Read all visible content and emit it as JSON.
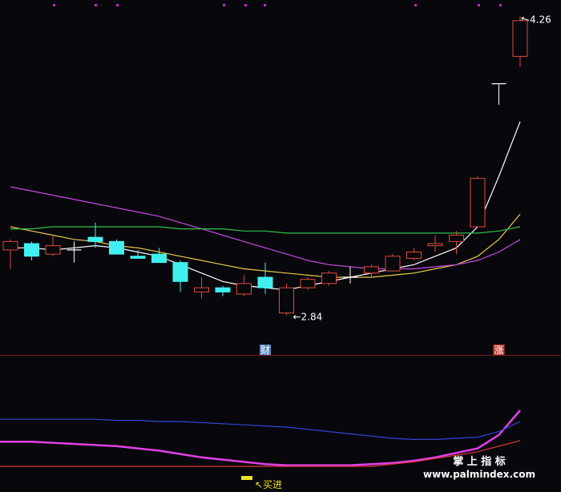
{
  "chart_data": {
    "type": "candlestick",
    "main_panel": {
      "y_range": [
        2.7,
        4.3
      ],
      "candles": [
        {
          "o": 3.15,
          "h": 3.2,
          "l": 3.06,
          "c": 3.19
        },
        {
          "o": 3.18,
          "h": 3.19,
          "l": 3.1,
          "c": 3.12
        },
        {
          "o": 3.13,
          "h": 3.22,
          "l": 3.12,
          "c": 3.17
        },
        {
          "o": 3.15,
          "h": 3.19,
          "l": 3.09,
          "c": 3.15
        },
        {
          "o": 3.21,
          "h": 3.28,
          "l": 3.16,
          "c": 3.19
        },
        {
          "o": 3.19,
          "h": 3.2,
          "l": 3.13,
          "c": 3.13
        },
        {
          "o": 3.12,
          "h": 3.15,
          "l": 3.11,
          "c": 3.11
        },
        {
          "o": 3.13,
          "h": 3.16,
          "l": 3.09,
          "c": 3.09
        },
        {
          "o": 3.09,
          "h": 3.1,
          "l": 2.95,
          "c": 3.0
        },
        {
          "o": 2.95,
          "h": 3.02,
          "l": 2.92,
          "c": 2.97
        },
        {
          "o": 2.97,
          "h": 2.98,
          "l": 2.93,
          "c": 2.95
        },
        {
          "o": 2.94,
          "h": 3.03,
          "l": 2.93,
          "c": 2.99
        },
        {
          "o": 3.02,
          "h": 3.09,
          "l": 2.94,
          "c": 2.97
        },
        {
          "o": 2.85,
          "h": 2.99,
          "l": 2.84,
          "c": 2.97
        },
        {
          "o": 2.97,
          "h": 3.02,
          "l": 2.96,
          "c": 3.01
        },
        {
          "o": 2.99,
          "h": 3.05,
          "l": 2.98,
          "c": 3.04
        },
        {
          "o": 3.02,
          "h": 3.07,
          "l": 2.99,
          "c": 3.02
        },
        {
          "o": 3.04,
          "h": 3.08,
          "l": 3.02,
          "c": 3.07
        },
        {
          "o": 3.05,
          "h": 3.13,
          "l": 3.05,
          "c": 3.12
        },
        {
          "o": 3.11,
          "h": 3.16,
          "l": 3.1,
          "c": 3.14
        },
        {
          "o": 3.17,
          "h": 3.22,
          "l": 3.14,
          "c": 3.18
        },
        {
          "o": 3.19,
          "h": 3.24,
          "l": 3.13,
          "c": 3.22
        },
        {
          "o": 3.26,
          "h": 3.5,
          "l": 3.26,
          "c": 3.49
        },
        {
          "o": 3.94,
          "h": 3.94,
          "l": 3.84,
          "c": 3.94
        },
        {
          "o": 4.07,
          "h": 4.26,
          "l": 4.02,
          "c": 4.24
        }
      ],
      "lines": [
        {
          "color": "#ffffff",
          "values": [
            3.16,
            3.16,
            3.15,
            3.16,
            3.17,
            3.16,
            3.14,
            3.12,
            3.08,
            3.04,
            3.0,
            2.98,
            2.97,
            2.96,
            2.98,
            3.0,
            3.02,
            3.04,
            3.06,
            3.08,
            3.12,
            3.16,
            3.26,
            3.5,
            3.76
          ]
        },
        {
          "color": "#e8c84a",
          "values": [
            3.26,
            3.24,
            3.22,
            3.2,
            3.19,
            3.17,
            3.16,
            3.14,
            3.12,
            3.1,
            3.08,
            3.06,
            3.05,
            3.04,
            3.03,
            3.02,
            3.02,
            3.02,
            3.03,
            3.04,
            3.06,
            3.08,
            3.12,
            3.2,
            3.32
          ]
        },
        {
          "color": "#c548e0",
          "values": [
            3.45,
            3.43,
            3.41,
            3.39,
            3.37,
            3.35,
            3.33,
            3.31,
            3.28,
            3.25,
            3.22,
            3.19,
            3.16,
            3.13,
            3.1,
            3.08,
            3.07,
            3.06,
            3.06,
            3.06,
            3.07,
            3.08,
            3.1,
            3.14,
            3.2
          ]
        },
        {
          "color": "#2fc24a",
          "values": [
            3.25,
            3.25,
            3.26,
            3.26,
            3.26,
            3.26,
            3.26,
            3.26,
            3.25,
            3.25,
            3.25,
            3.24,
            3.24,
            3.23,
            3.23,
            3.23,
            3.23,
            3.23,
            3.23,
            3.23,
            3.23,
            3.23,
            3.23,
            3.24,
            3.26
          ]
        }
      ],
      "annotations": [
        {
          "text": "4.26",
          "candle": 24,
          "at": "high"
        },
        {
          "text": "←2.84",
          "candle": 13,
          "at": "low"
        }
      ],
      "badges": [
        {
          "text": "财",
          "candle": 12,
          "color": "#6a9fe0"
        },
        {
          "text": "涨",
          "candle": 23,
          "color": "#e04a3a"
        }
      ]
    },
    "indicator_panel": {
      "y_range": [
        0,
        1
      ],
      "lines": [
        {
          "color": "#e040e8",
          "values": [
            0.42,
            0.42,
            0.41,
            0.4,
            0.39,
            0.38,
            0.36,
            0.34,
            0.31,
            0.28,
            0.26,
            0.24,
            0.22,
            0.21,
            0.21,
            0.21,
            0.21,
            0.22,
            0.23,
            0.25,
            0.28,
            0.32,
            0.36,
            0.48,
            0.7
          ]
        },
        {
          "color": "#3146d8",
          "values": [
            0.62,
            0.62,
            0.62,
            0.62,
            0.62,
            0.61,
            0.61,
            0.6,
            0.6,
            0.59,
            0.58,
            0.57,
            0.56,
            0.55,
            0.53,
            0.51,
            0.49,
            0.47,
            0.45,
            0.44,
            0.44,
            0.45,
            0.46,
            0.51,
            0.6
          ]
        },
        {
          "color": "#e03a3a",
          "values": [
            0.2,
            0.2,
            0.2,
            0.2,
            0.2,
            0.2,
            0.2,
            0.2,
            0.2,
            0.2,
            0.2,
            0.2,
            0.2,
            0.2,
            0.2,
            0.2,
            0.2,
            0.2,
            0.22,
            0.24,
            0.27,
            0.3,
            0.33,
            0.38,
            0.43
          ]
        }
      ],
      "signal": {
        "text": "↖买进",
        "candle": 12
      }
    },
    "colors": {
      "up": "#e04a3a",
      "down": "#40f0f0",
      "flat": "#ffffff",
      "divider": "#7a1a1a",
      "background": "#08070c"
    }
  },
  "watermark": {
    "title": "掌 上 指 标",
    "url": "www.palmindex.com"
  }
}
